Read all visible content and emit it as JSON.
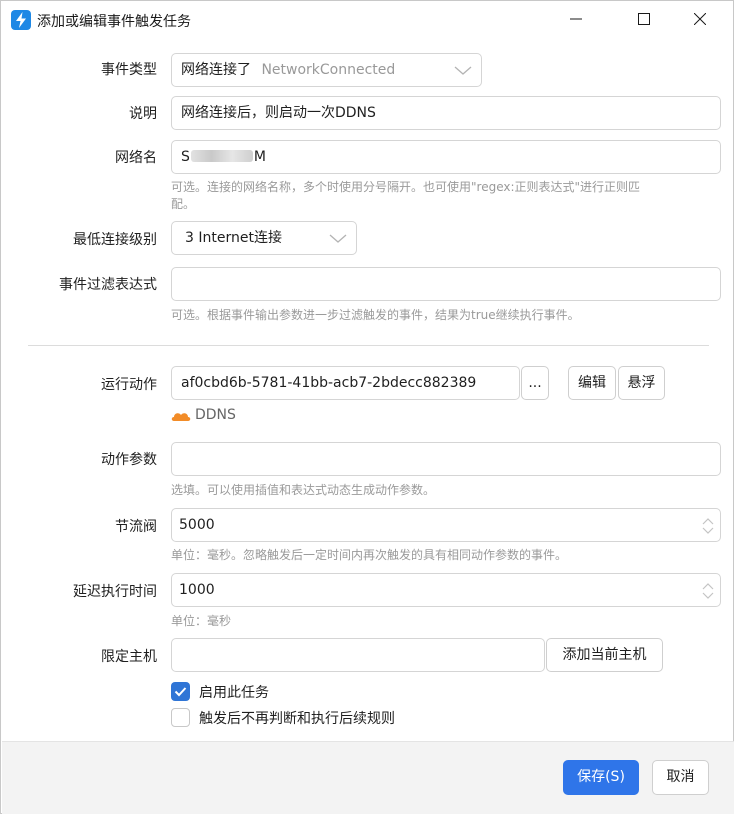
{
  "window": {
    "title": "添加或编辑事件触发任务",
    "icon": "lightning-app-icon",
    "controls": [
      "minimize-icon",
      "maximize-icon",
      "close-icon"
    ]
  },
  "form": {
    "event_type": {
      "label": "事件类型",
      "value_cn": "网络连接了",
      "value_en": "NetworkConnected"
    },
    "description": {
      "label": "说明",
      "value": "网络连接后，则启动一次DDNS"
    },
    "network_name": {
      "label": "网络名",
      "value_start": "S",
      "value_end": "M",
      "hint": "可选。连接的网络名称，多个时使用分号隔开。也可使用\"regex:正则表达式\"进行正则匹",
      "hint_cont": "配。"
    },
    "min_level": {
      "label": "最低连接级别",
      "value": "3 Internet连接"
    },
    "filter": {
      "label": "事件过滤表达式",
      "value": "",
      "hint": "可选。根据事件输出参数进一步过滤触发的事件，结果为true继续执行事件。"
    },
    "action": {
      "label": "运行动作",
      "value": "af0cbd6b-5781-41bb-acb7-2bdecc882389",
      "browse_label": "...",
      "edit_label": "编辑",
      "float_label": "悬浮",
      "linked_name": "DDNS",
      "linked_icon": "cloud-icon",
      "linked_color": "#f28c28"
    },
    "action_params": {
      "label": "动作参数",
      "value": "",
      "hint": "选填。可以使用插值和表达式动态生成动作参数。"
    },
    "throttle": {
      "label": "节流阀",
      "value": "5000",
      "hint": "单位：毫秒。忽略触发后一定时间内再次触发的具有相同动作参数的事件。"
    },
    "delay": {
      "label": "延迟执行时间",
      "value": "1000",
      "hint": "单位：毫秒"
    },
    "host": {
      "label": "限定主机",
      "value": "",
      "add_label": "添加当前主机"
    },
    "enable_task": {
      "label": "启用此任务",
      "checked": true
    },
    "stop_after": {
      "label": "触发后不再判断和执行后续规则",
      "checked": false
    }
  },
  "footer": {
    "save_label": "保存(S)",
    "cancel_label": "取消"
  },
  "colors": {
    "accent": "#2f75e9",
    "checkbox": "#2f75d6",
    "hint_text": "#9a9a9a"
  }
}
